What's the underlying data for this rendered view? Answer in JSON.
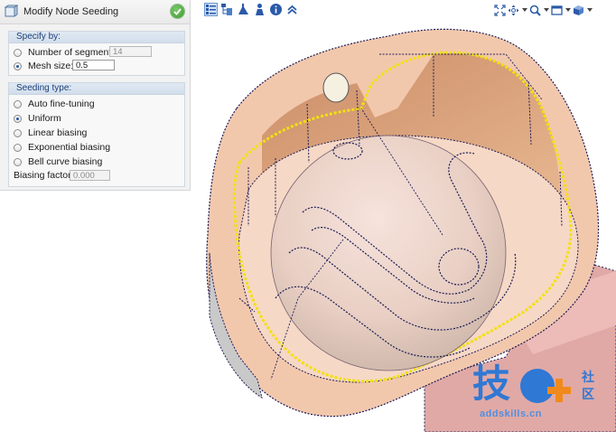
{
  "panel": {
    "title": "Modify Node Seeding",
    "title_icon": "seed-edge-icon",
    "ok_icon": "check-circle-icon",
    "specify": {
      "header": "Specify by:",
      "options": [
        {
          "label": "Number of segments:",
          "selected": false,
          "value": "14",
          "enabled": false
        },
        {
          "label": "Mesh size:",
          "selected": true,
          "value": "0.5",
          "enabled": true
        }
      ]
    },
    "seeding": {
      "header": "Seeding type:",
      "options": [
        {
          "label": "Auto fine-tuning",
          "selected": false
        },
        {
          "label": "Uniform",
          "selected": true
        },
        {
          "label": "Linear biasing",
          "selected": false
        },
        {
          "label": "Exponential biasing",
          "selected": false
        },
        {
          "label": "Bell curve biasing",
          "selected": false
        }
      ],
      "biasing_label": "Biasing factor:",
      "biasing_value": "0.000"
    }
  },
  "toolbar": {
    "left": [
      "list-view-icon",
      "tree-view-icon",
      "mesh-tool-icon",
      "person-icon",
      "info-icon",
      "collapse-up-icon"
    ],
    "right": [
      "fit-view-icon",
      "pan-icon",
      "zoom-icon",
      "view-box-icon",
      "cube-view-icon"
    ]
  },
  "watermark": {
    "main": "技",
    "side_top": "社",
    "side_bottom": "区",
    "url": "addskills.cn"
  },
  "colors": {
    "accent": "#2f78d4",
    "panel_header": "#1c3f78",
    "seed_node": "#1b1b55",
    "highlight_edge": "#f2e10f"
  }
}
